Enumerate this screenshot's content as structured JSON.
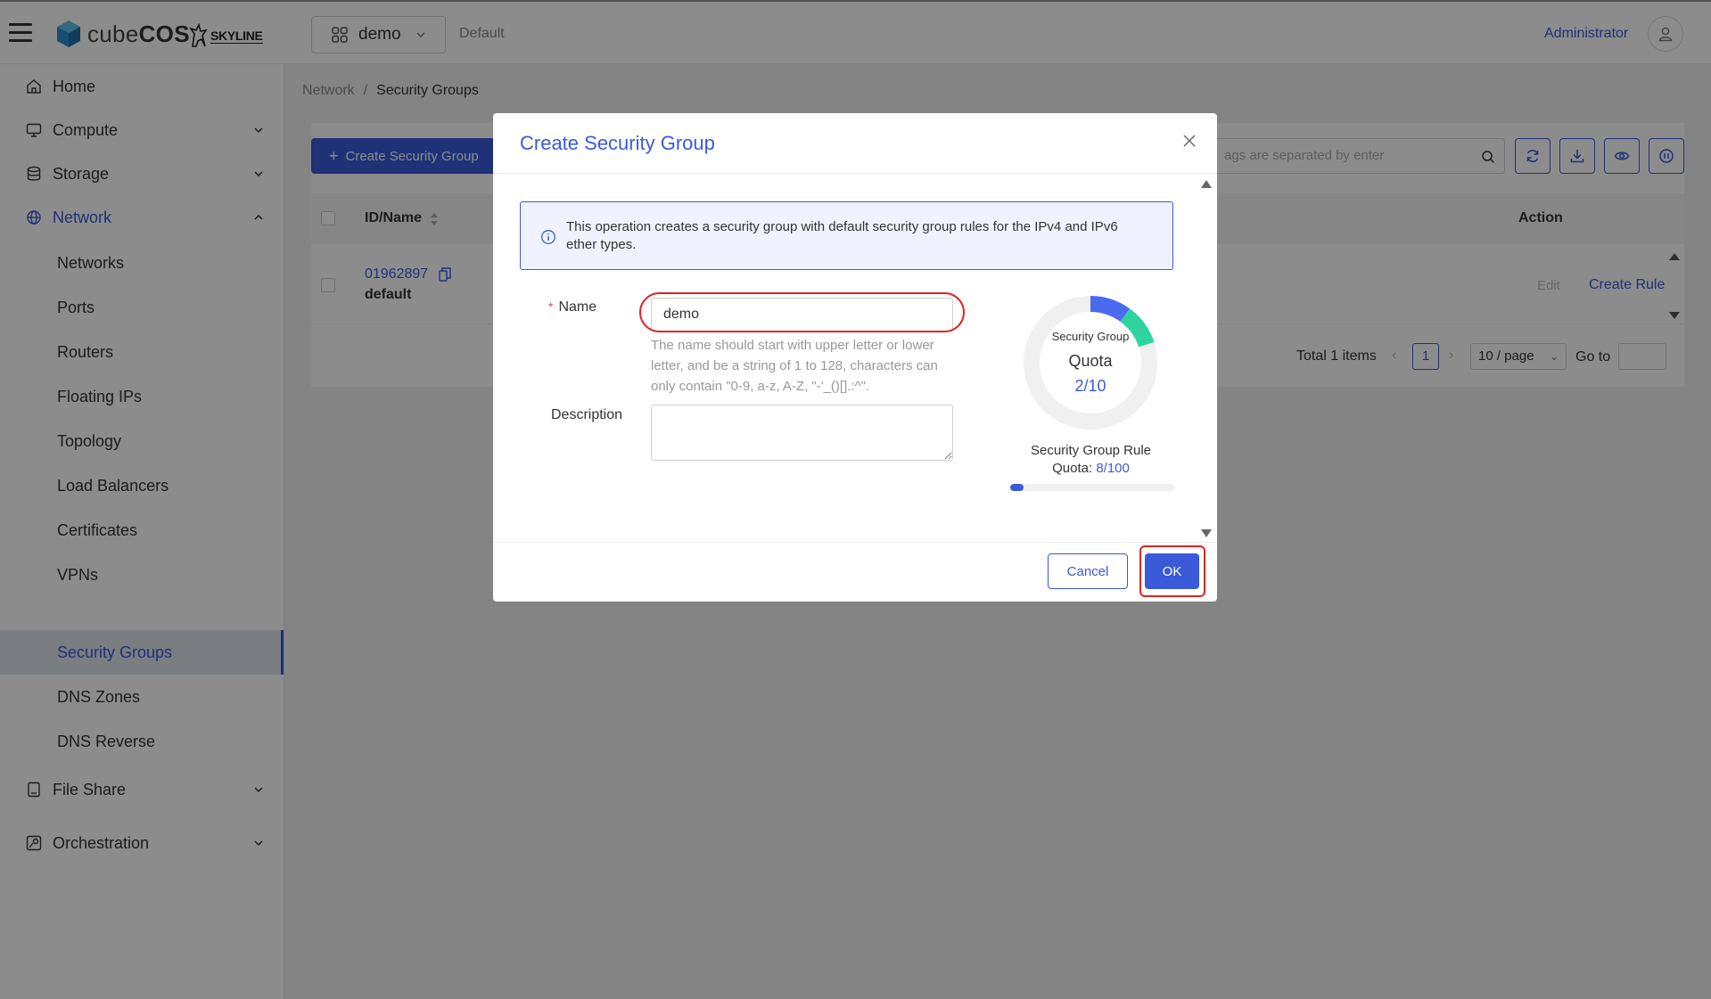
{
  "header": {
    "brand_prefix": "cube",
    "brand_suffix": "COS",
    "partner_logo": "SKYLINE",
    "project": "demo",
    "domain": "Default",
    "user": "Administrator"
  },
  "sidebar": {
    "items": [
      {
        "label": "Home",
        "icon": "home-icon"
      },
      {
        "label": "Compute",
        "icon": "monitor-icon"
      },
      {
        "label": "Storage",
        "icon": "database-icon"
      },
      {
        "label": "Network",
        "icon": "globe-icon"
      },
      {
        "label": "File Share",
        "icon": "file-icon"
      },
      {
        "label": "Orchestration",
        "icon": "orchestration-icon"
      }
    ],
    "network_children": [
      "Networks",
      "Ports",
      "Routers",
      "Floating IPs",
      "Topology",
      "Load Balancers",
      "Certificates",
      "VPNs",
      "Security Groups",
      "DNS Zones",
      "DNS Reverse"
    ],
    "selected": "Security Groups"
  },
  "breadcrumb": {
    "parent": "Network",
    "separator": "/",
    "current": "Security Groups"
  },
  "toolbar": {
    "create_label": "Create Security Group",
    "search_placeholder": "ags are separated by enter"
  },
  "table": {
    "headers": {
      "id_name": "ID/Name",
      "action": "Action"
    },
    "rows": [
      {
        "id": "01962897",
        "name": "default",
        "edit": "Edit",
        "create_rule": "Create Rule"
      }
    ]
  },
  "pagination": {
    "total": "Total 1 items",
    "page": "1",
    "page_size": "10 / page",
    "goto": "Go to"
  },
  "modal": {
    "title": "Create Security Group",
    "info": "This operation creates a security group with default security group rules for the IPv4 and IPv6 ether types.",
    "name_label": "Name",
    "name_value": "demo",
    "name_help": "The name should start with upper letter or lower letter, and be a string of 1 to 128, characters can only contain \"0-9, a-z, A-Z, \"-'_()[].:^\".",
    "description_label": "Description",
    "sg_quota": {
      "title": "Security Group",
      "subtitle": "Quota",
      "used": 2,
      "total": 10,
      "display": "2/10"
    },
    "rule_quota": {
      "title": "Security Group Rule",
      "label": "Quota:",
      "display": "8/100",
      "used": 8,
      "total": 100
    },
    "cancel_label": "Cancel",
    "ok_label": "OK"
  },
  "colors": {
    "primary": "#3a5ad9",
    "accent_teal": "#2ed3a0",
    "highlight_red": "#e02424"
  }
}
